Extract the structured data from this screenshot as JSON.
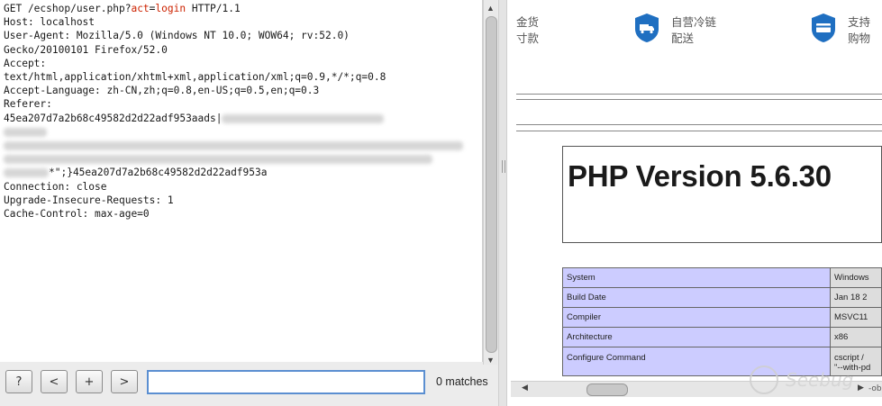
{
  "request": {
    "line1_method_path": "GET /ecshop/user.php?",
    "line1_param": "act",
    "line1_eq": "=",
    "line1_value": "login",
    "line1_proto": " HTTP/1.1",
    "host": "Host: localhost",
    "ua1": "User-Agent: Mozilla/5.0 (Windows NT 10.0; WOW64; rv:52.0)",
    "ua2": "Gecko/20100101 Firefox/52.0",
    "accept": "Accept:",
    "accept_val": "text/html,application/xhtml+xml,application/xml;q=0.9,*/*;q=0.8",
    "accept_lang": "Accept-Language: zh-CN,zh;q=0.8,en-US;q=0.5,en;q=0.3",
    "referer": "Referer:",
    "referer_val": "45ea207d7a2b68c49582d2d22adf953aads|",
    "referer_tail": "*\";}45ea207d7a2b68c49582d2d22adf953a",
    "connection": "Connection: close",
    "upgrade": "Upgrade-Insecure-Requests: 1",
    "cache": "Cache-Control: max-age=0"
  },
  "toolbar": {
    "help_label": "?",
    "prev_label": "<",
    "add_label": "+",
    "next_label": ">",
    "search_value": "",
    "matches": "0 matches"
  },
  "page": {
    "cn_cut_1a": "金货",
    "cn_cut_1b": "寸款",
    "service_cold_1": "自营冷链",
    "service_cold_2": "配送",
    "service_pay_1": "支持",
    "service_pay_2": "购物",
    "php_version": "PHP Version 5.6.30",
    "rows": [
      {
        "key": "System",
        "value": "Windows"
      },
      {
        "key": "Build Date",
        "value": "Jan 18 2"
      },
      {
        "key": "Compiler",
        "value": "MSVC11"
      },
      {
        "key": "Architecture",
        "value": "x86"
      },
      {
        "key": "Configure Command",
        "value": "cscript /"
      }
    ],
    "configure_tail": "\"--with-pd",
    "hscroll_tail": "-ob"
  },
  "watermark": {
    "text": "Seebug"
  },
  "colors": {
    "accent": "#1f6fc1",
    "param": "#cc2200",
    "php_key_bg": "#ccccff"
  }
}
